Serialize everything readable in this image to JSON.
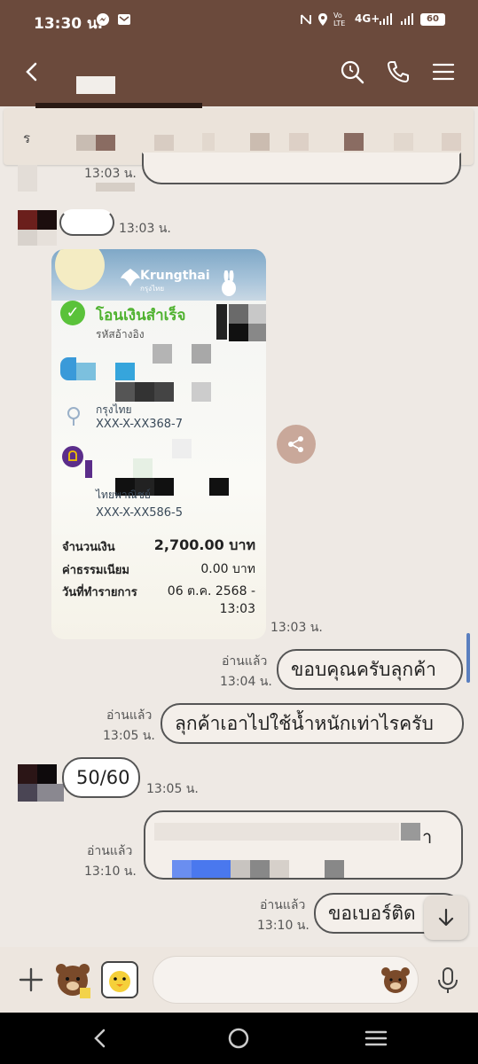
{
  "status_bar": {
    "time": "13:30 น.",
    "network": "4G+",
    "battery": "60"
  },
  "header": {
    "back_icon": "chevron-left-icon",
    "search_icon": "search-icon",
    "call_icon": "phone-icon",
    "menu_icon": "menu-icon"
  },
  "announcement": {
    "icon": "ร"
  },
  "messages": {
    "m1_time": "13:03 น.",
    "m2_time": "13:03 น.",
    "m3_time": "13:03 น.",
    "m4_read": "อ่านแล้ว",
    "m4_time": "13:04 น.",
    "m4_text": "ขอบคุณครับลุกค้า",
    "m5_read": "อ่านแล้ว",
    "m5_time": "13:05 น.",
    "m5_text": "ลุกค้าเอาไปใช้น้ำหนักเท่าไรครับ",
    "m6_text": "50/60",
    "m6_time": "13:05 น.",
    "m7_read": "อ่านแล้ว",
    "m7_time": "13:10 น.",
    "m7_tail": "า",
    "m8_read": "อ่านแล้ว",
    "m8_time": "13:10 น.",
    "m8_text": "ขอเบอร์ติด"
  },
  "receipt": {
    "bank": "Krungthai",
    "bank_sub": "กรุงไทย",
    "status": "โอนเงินสำเร็จ",
    "ref_label": "รหัสอ้างอิง",
    "from_bank": "กรุงไทย",
    "from_account": "XXX-X-XX368-7",
    "to_bank": "ไทยพาณิชย์",
    "to_account": "XXX-X-XX586-5",
    "amount_label": "จำนวนเงิน",
    "amount_value": "2,700.00 บาท",
    "fee_label": "ค่าธรรมเนียม",
    "fee_value": "0.00 บาท",
    "date_label": "วันที่ทำรายการ",
    "date_value": "06 ต.ค. 2568 -",
    "time_value": "13:03"
  },
  "input": {
    "placeholder": ""
  }
}
